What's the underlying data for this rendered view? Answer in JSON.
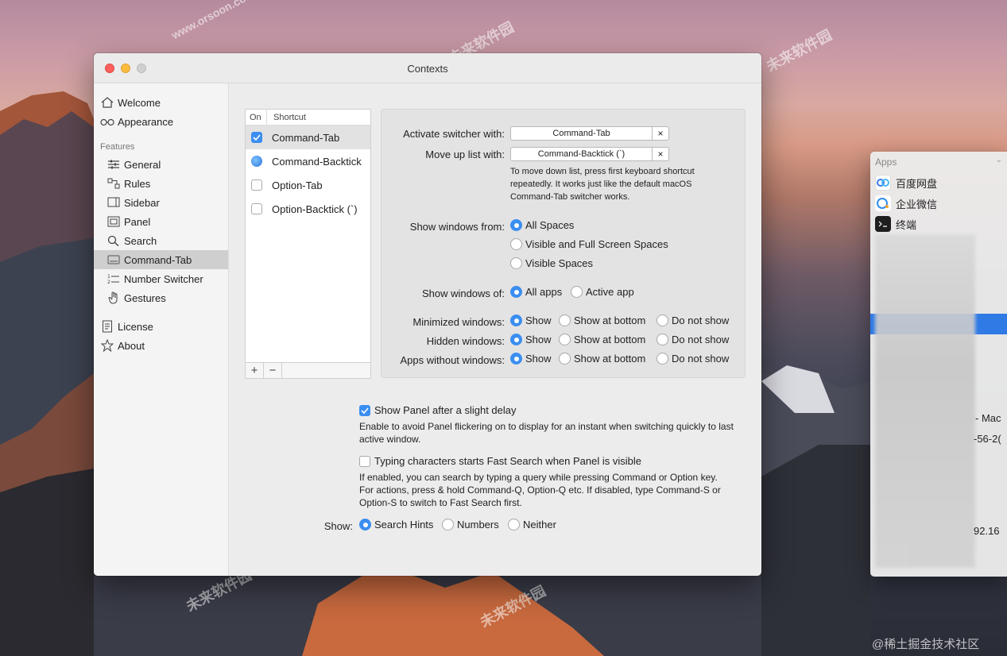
{
  "window": {
    "title": "Contexts"
  },
  "sidebar": {
    "top_items": [
      {
        "label": "Welcome",
        "icon": "home-icon"
      },
      {
        "label": "Appearance",
        "icon": "glasses-icon"
      }
    ],
    "section_label": "Features",
    "feature_items": [
      {
        "label": "General",
        "icon": "sliders-icon"
      },
      {
        "label": "Rules",
        "icon": "rules-icon"
      },
      {
        "label": "Sidebar",
        "icon": "sidebar-icon"
      },
      {
        "label": "Panel",
        "icon": "panel-icon"
      },
      {
        "label": "Search",
        "icon": "search-icon"
      },
      {
        "label": "Command-Tab",
        "icon": "keyboard-icon",
        "selected": true
      },
      {
        "label": "Number Switcher",
        "icon": "number-list-icon"
      },
      {
        "label": "Gestures",
        "icon": "hand-icon"
      }
    ],
    "bottom_items": [
      {
        "label": "License",
        "icon": "license-icon"
      },
      {
        "label": "About",
        "icon": "star-icon"
      }
    ]
  },
  "shortcuts": {
    "col_on": "On",
    "col_shortcut": "Shortcut",
    "rows": [
      {
        "label": "Command-Tab",
        "checked": true
      },
      {
        "label": "Command-Backtick",
        "checked": false
      },
      {
        "label": "Option-Tab",
        "checked": false
      },
      {
        "label": "Option-Backtick (`)",
        "checked": false
      }
    ],
    "add_label": "+",
    "remove_label": "−"
  },
  "settings": {
    "activate_label": "Activate switcher with:",
    "activate_value": "Command-Tab",
    "moveup_label": "Move up list with:",
    "moveup_value": "Command-Backtick (`)",
    "clear_glyph": "×",
    "moveup_note": "To move down list, press first keyboard shortcut repeatedly. It works just like the default macOS Command-Tab switcher works.",
    "show_from_label": "Show windows from:",
    "show_from_options": [
      "All Spaces",
      "Visible and Full Screen Spaces",
      "Visible Spaces"
    ],
    "show_of_label": "Show windows of:",
    "show_of_options": [
      "All apps",
      "Active app"
    ],
    "minimized_label": "Minimized windows:",
    "hidden_label": "Hidden windows:",
    "nowindows_label": "Apps without windows:",
    "tri_options": [
      "Show",
      "Show at bottom",
      "Do not show"
    ]
  },
  "bottom": {
    "delay_label": "Show Panel after a slight delay",
    "delay_note": "Enable to avoid Panel flickering on to display for an instant when switching quickly to last active window.",
    "typing_label": "Typing characters starts Fast Search when Panel is visible",
    "typing_note": "If enabled, you can search by typing a query while pressing Command or Option key. For actions, press & hold Command-Q, Option-Q etc. If disabled, type Command-S or Option-S to switch to Fast Search first.",
    "show_label": "Show:",
    "show_options": [
      "Search Hints",
      "Numbers",
      "Neither"
    ]
  },
  "apps_panel": {
    "header": "Apps",
    "items": [
      "百度网盘",
      "企业微信",
      "终端"
    ],
    "fragments": [
      "- Mac",
      "-56-2(",
      "92.16"
    ]
  },
  "watermarks": [
    "未来软件园",
    "www.orsoon.com",
    "@稀土掘金技术社区"
  ]
}
